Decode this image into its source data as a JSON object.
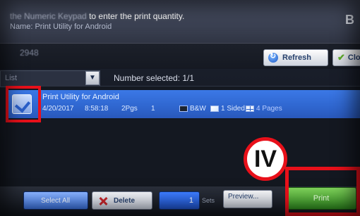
{
  "header": {
    "line1_faded": "the Numeric Keypad",
    "line1_main": "to enter the print quantity.",
    "line2": "Name: Print Utility for Android",
    "corner": "B"
  },
  "toolbar": {
    "job_id": "2948",
    "refresh_label": "Refresh",
    "close_label": "Clo"
  },
  "filter": {
    "value": "List",
    "number_selected": "Number selected: 1/1"
  },
  "job": {
    "title": "Print Utility for Android",
    "date": "4/20/2017",
    "time": "8:58:18",
    "pages": "2Pgs",
    "count": "1",
    "color": "B&W",
    "sided": "1 Sided",
    "layout": "4 Pages",
    "selected": true
  },
  "bottom": {
    "select_all_label": "Select All",
    "delete_label": "Delete",
    "sets_value": "1",
    "sets_label": "Sets",
    "preview_label": "Preview...",
    "print_label": "Print"
  },
  "annotation": {
    "badge": "IV"
  },
  "colors": {
    "highlight": "#2f66cf",
    "annotation_red": "#e8101a",
    "print_green": "#2f8a1f"
  }
}
